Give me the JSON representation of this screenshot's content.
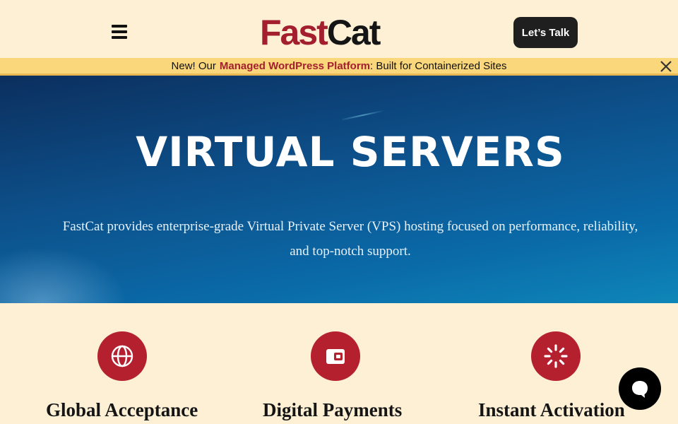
{
  "header": {
    "logo_part1": "Fast",
    "logo_part2": "Cat",
    "menu_icon": "hamburger-menu-icon",
    "cta_label": "Let’s Talk"
  },
  "announcement": {
    "prefix": "New! Our",
    "highlight": "Managed WordPress Platform",
    "suffix": ": Built for Containerized Sites",
    "close_icon": "close-icon"
  },
  "hero": {
    "title": "VIRTUAL SERVERS",
    "description": "FastCat provides enterprise-grade Virtual Private Server (VPS) hosting focused on performance, reliability, and top-notch support."
  },
  "features": [
    {
      "icon": "globe-icon",
      "title": "Global Acceptance"
    },
    {
      "icon": "wallet-icon",
      "title": "Digital Payments"
    },
    {
      "icon": "loading-spinner-icon",
      "title": "Instant Activation"
    }
  ],
  "chat": {
    "icon": "chat-bubble-icon"
  },
  "colors": {
    "brand_red": "#a31e2e",
    "background_cream": "#fdf0d5",
    "announce_yellow": "#fbd77c",
    "hero_blue": "#0d4f89"
  }
}
